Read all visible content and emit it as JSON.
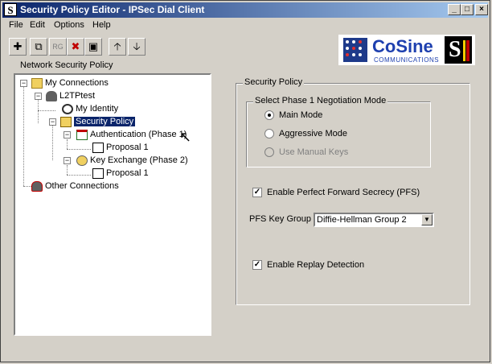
{
  "window": {
    "title": "Security Policy Editor - IPSec Dial Client",
    "app_icon_letter": "S",
    "controls": {
      "minimize": "_",
      "maximize": "□",
      "close": "×"
    }
  },
  "menu": [
    "File",
    "Edit",
    "Options",
    "Help"
  ],
  "toolbar": [
    {
      "icon": "new-connection-icon",
      "glyph": "✚"
    },
    {
      "icon": "copy-icon",
      "glyph": "⧉"
    },
    {
      "icon": "rg-icon",
      "glyph": "RG"
    },
    {
      "icon": "delete-icon",
      "glyph": "✖"
    },
    {
      "icon": "save-icon",
      "glyph": "▣"
    },
    {
      "icon": "move-up-icon",
      "glyph": "🡡"
    },
    {
      "icon": "move-down-icon",
      "glyph": "🡣"
    }
  ],
  "branding": {
    "logo_text": "CoSine",
    "logo_subtext": "COMMUNICATIONS",
    "badge_letter": "S"
  },
  "tree": {
    "label": "Network Security Policy",
    "nodes": [
      {
        "label": "My Connections"
      },
      {
        "label": "L2TPtest"
      },
      {
        "label": "My Identity"
      },
      {
        "label": "Security Policy"
      },
      {
        "label": "Authentication (Phase 1)"
      },
      {
        "label": "Proposal 1"
      },
      {
        "label": "Key Exchange (Phase 2)"
      },
      {
        "label": "Proposal 1"
      },
      {
        "label": "Other Connections"
      }
    ]
  },
  "security_policy": {
    "group_title": "Security Policy",
    "phase1_group_title": "Select Phase 1 Negotiation Mode",
    "modes": [
      {
        "label": "Main Mode",
        "checked": true,
        "disabled": false
      },
      {
        "label": "Aggressive Mode",
        "checked": false,
        "disabled": false
      },
      {
        "label": "Use Manual Keys",
        "checked": false,
        "disabled": true
      }
    ],
    "pfs": {
      "label": "Enable Perfect Forward Secrecy (PFS)",
      "checked": true
    },
    "pfs_key_group": {
      "label": "PFS Key Group",
      "value": "Diffie-Hellman Group 2"
    },
    "replay": {
      "label": "Enable Replay Detection",
      "checked": true
    }
  }
}
